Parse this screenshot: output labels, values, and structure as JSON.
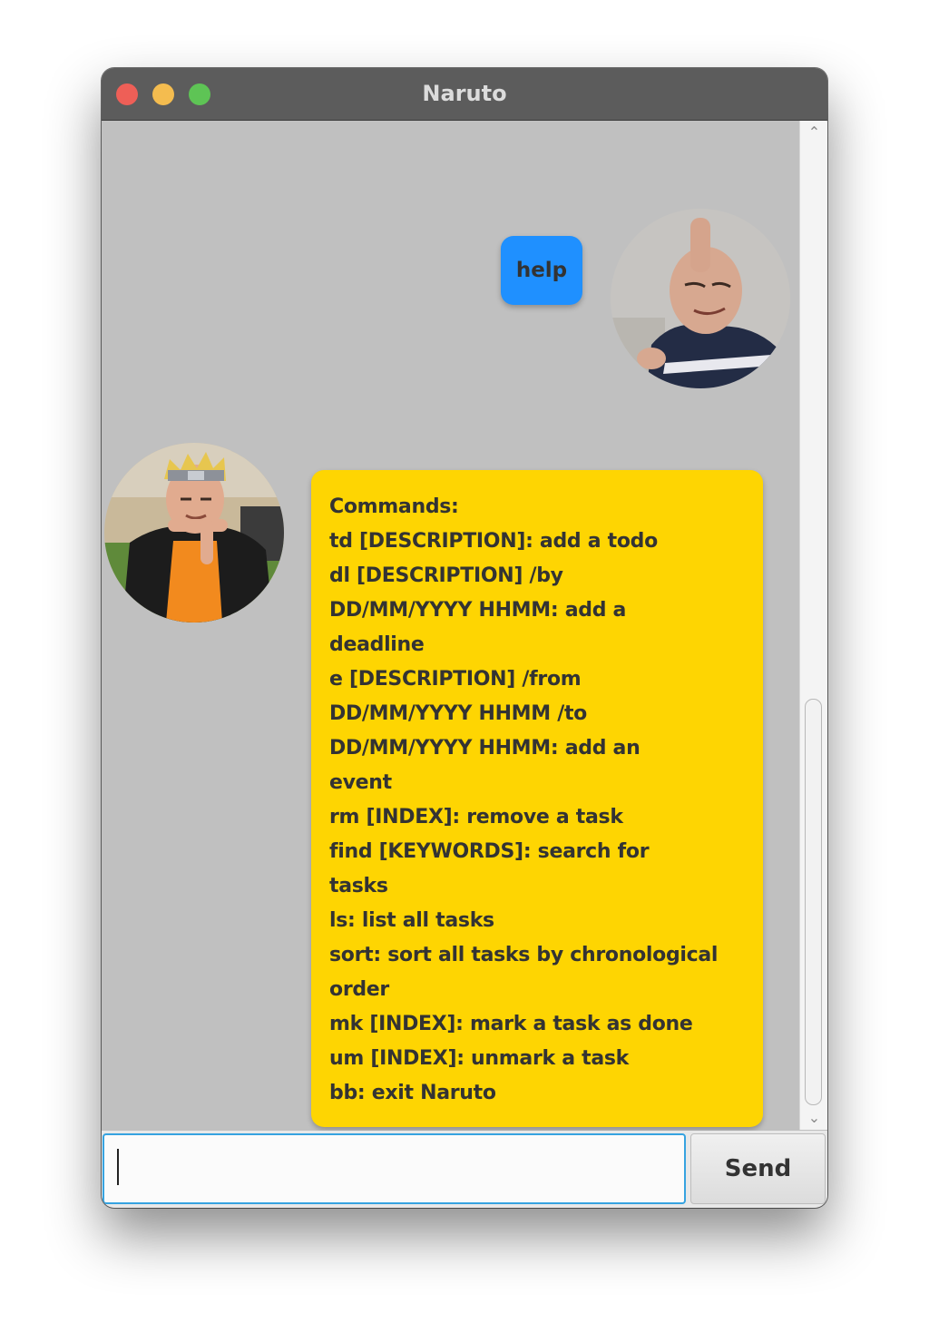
{
  "window": {
    "title": "Naruto"
  },
  "chat": {
    "user_message": "help",
    "bot_message_lines": [
      "Commands:",
      "td [DESCRIPTION]: add a todo",
      "dl [DESCRIPTION] /by",
      "DD/MM/YYYY HHMM: add a",
      "deadline",
      "e [DESCRIPTION] /from",
      "DD/MM/YYYY HHMM /to",
      "DD/MM/YYYY HHMM: add an",
      "event",
      "rm [INDEX]: remove a task",
      "find [KEYWORDS]: search for",
      "tasks",
      "ls: list all tasks",
      "sort: sort all tasks by chronological",
      "order",
      "mk [INDEX]: mark a task as done",
      "um [INDEX]: unmark a task",
      "bb: exit Naruto"
    ]
  },
  "input": {
    "value": "",
    "send_label": "Send"
  },
  "colors": {
    "user_bubble": "#1f90ff",
    "bot_bubble": "#fed502",
    "chat_background": "#c0c0c0",
    "titlebar": "#5c5c5c"
  },
  "icons": {
    "scroll_up": "chevron-up-icon",
    "scroll_down": "chevron-down-icon"
  }
}
